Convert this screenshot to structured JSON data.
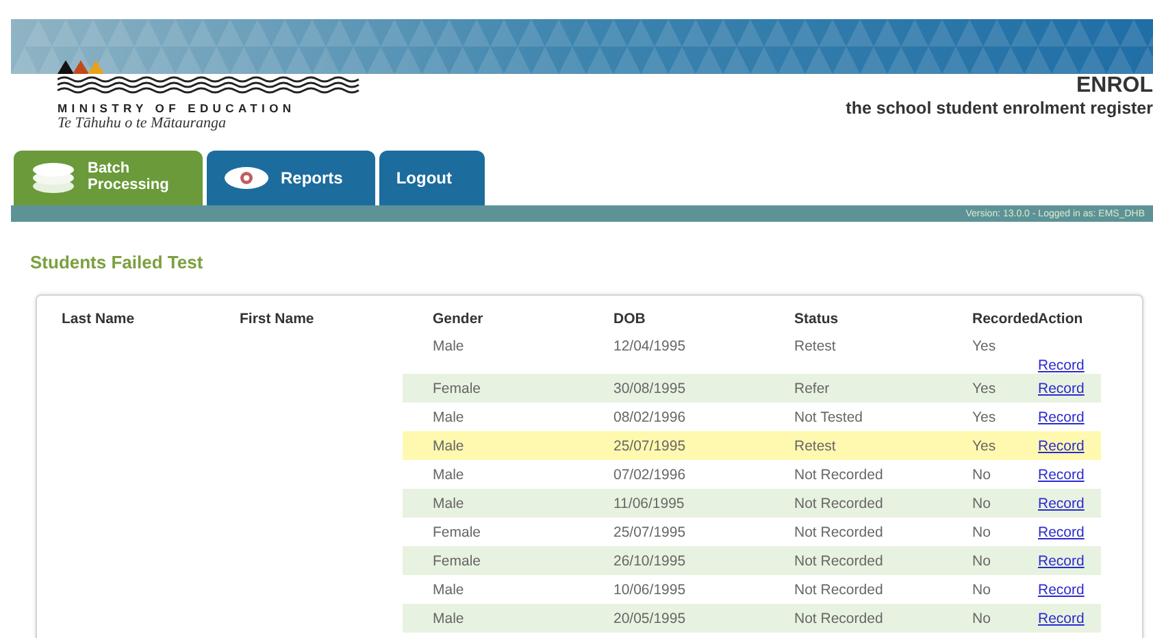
{
  "header": {
    "ministry": "MINISTRY OF EDUCATION",
    "tagline": "Te Tāhuhu o te Mātauranga",
    "app_name": "ENROL",
    "app_subtitle": "the school student enrolment register"
  },
  "tabs": [
    {
      "label": "Batch Processing",
      "kind": "layers",
      "selected": true
    },
    {
      "label": "Reports",
      "kind": "eye",
      "selected": false
    },
    {
      "label": "Logout",
      "kind": "plain",
      "selected": false
    }
  ],
  "version_text": "Version: 13.0.0 - Logged in as: EMS_DHB",
  "page_title": "Students Failed Test",
  "table": {
    "columns": [
      "Last Name",
      "First Name",
      "Gender",
      "DOB",
      "Status",
      "Recorded",
      "Action"
    ],
    "rows": [
      {
        "gender": "Male",
        "dob": "12/04/1995",
        "status": "Retest",
        "recorded": "Yes",
        "action": "Record",
        "highlighted": false
      },
      {
        "gender": "Female",
        "dob": "30/08/1995",
        "status": "Refer",
        "recorded": "Yes",
        "action": "Record",
        "highlighted": false
      },
      {
        "gender": "Male",
        "dob": "08/02/1996",
        "status": "Not Tested",
        "recorded": "Yes",
        "action": "Record",
        "highlighted": false
      },
      {
        "gender": "Male",
        "dob": "25/07/1995",
        "status": "Retest",
        "recorded": "Yes",
        "action": "Record",
        "highlighted": true
      },
      {
        "gender": "Male",
        "dob": "07/02/1996",
        "status": "Not Recorded",
        "recorded": "No",
        "action": "Record",
        "highlighted": false
      },
      {
        "gender": "Male",
        "dob": "11/06/1995",
        "status": "Not Recorded",
        "recorded": "No",
        "action": "Record",
        "highlighted": false
      },
      {
        "gender": "Female",
        "dob": "25/07/1995",
        "status": "Not Recorded",
        "recorded": "No",
        "action": "Record",
        "highlighted": false
      },
      {
        "gender": "Female",
        "dob": "26/10/1995",
        "status": "Not Recorded",
        "recorded": "No",
        "action": "Record",
        "highlighted": false
      },
      {
        "gender": "Male",
        "dob": "10/06/1995",
        "status": "Not Recorded",
        "recorded": "No",
        "action": "Record",
        "highlighted": false
      },
      {
        "gender": "Male",
        "dob": "20/05/1995",
        "status": "Not Recorded",
        "recorded": "No",
        "action": "Record",
        "highlighted": false
      }
    ]
  }
}
